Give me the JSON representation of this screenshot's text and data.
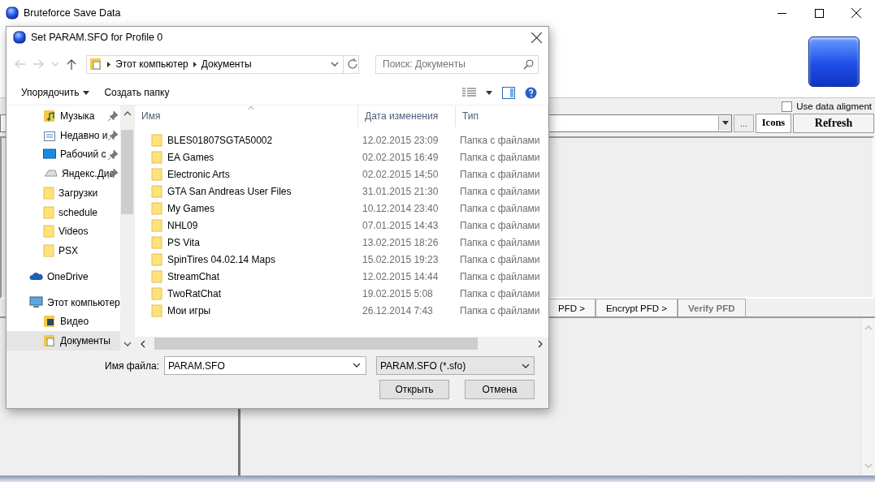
{
  "main_window": {
    "title": "Bruteforce Save Data",
    "align_option": {
      "label": "Use data aligment",
      "checked": false
    },
    "browse_button": "...",
    "buttons": [
      {
        "label": "Icons",
        "kind": "toggle"
      },
      {
        "label": "Refresh",
        "kind": "push"
      }
    ],
    "tabs": [
      {
        "label": "PFD >",
        "selected": false
      },
      {
        "label": "Encrypt PFD >",
        "selected": false
      },
      {
        "label": "Verify PFD",
        "selected": true
      }
    ]
  },
  "dialog": {
    "title": "Set PARAM.SFO for Profile 0",
    "breadcrumb": [
      "Этот компьютер",
      "Документы"
    ],
    "search": {
      "placeholder": "Поиск: Документы"
    },
    "commands": [
      {
        "label": "Упорядочить",
        "kind": "menu"
      },
      {
        "label": "Создать папку",
        "kind": "plain"
      }
    ],
    "quick_access": [
      {
        "label": "Музыка",
        "kind": "music",
        "pinned": true,
        "selected": false
      },
      {
        "label": "Недавно и",
        "kind": "recent",
        "pinned": true,
        "selected": false
      },
      {
        "label": "Рабочий с",
        "kind": "desktop",
        "pinned": true,
        "selected": false
      },
      {
        "label": "Яндекс.Дис",
        "kind": "disk",
        "pinned": true,
        "selected": false
      },
      {
        "label": "Загрузки",
        "kind": "folder",
        "pinned": false,
        "selected": false
      },
      {
        "label": "schedule",
        "kind": "folder",
        "pinned": false,
        "selected": false
      },
      {
        "label": "Videos",
        "kind": "folder",
        "pinned": false,
        "selected": false
      },
      {
        "label": "PSX",
        "kind": "folder",
        "pinned": false,
        "selected": false
      }
    ],
    "nav_roots": [
      {
        "label": "OneDrive",
        "kind": "cloud",
        "selected": false
      },
      {
        "label": "Этот компьютер",
        "kind": "computer",
        "selected": false,
        "children": [
          {
            "label": "Видео",
            "kind": "video",
            "selected": false
          },
          {
            "label": "Документы",
            "kind": "docs",
            "selected": true
          }
        ]
      }
    ],
    "columns": [
      "Имя",
      "Дата изменения",
      "Тип"
    ],
    "rows": [
      {
        "name": "BLES01807SGTA50002",
        "date": "12.02.2015 23:09",
        "type": "Папка с файлами"
      },
      {
        "name": "EA Games",
        "date": "02.02.2015 16:49",
        "type": "Папка с файлами"
      },
      {
        "name": "Electronic Arts",
        "date": "02.02.2015 14:50",
        "type": "Папка с файлами"
      },
      {
        "name": "GTA San Andreas User Files",
        "date": "31.01.2015 21:30",
        "type": "Папка с файлами"
      },
      {
        "name": "My Games",
        "date": "10.12.2014 23:40",
        "type": "Папка с файлами"
      },
      {
        "name": "NHL09",
        "date": "07.01.2015 14:43",
        "type": "Папка с файлами"
      },
      {
        "name": "PS Vita",
        "date": "13.02.2015 18:26",
        "type": "Папка с файлами"
      },
      {
        "name": "SpinTires 04.02.14 Maps",
        "date": "15.02.2015 19:23",
        "type": "Папка с файлами"
      },
      {
        "name": "StreamChat",
        "date": "12.02.2015 14:44",
        "type": "Папка с файлами"
      },
      {
        "name": "TwoRatChat",
        "date": "19.02.2015 5:08",
        "type": "Папка с файлами"
      },
      {
        "name": "Мои игры",
        "date": "26.12.2014 7:43",
        "type": "Папка с файлами"
      }
    ],
    "file_name": {
      "label": "Имя файла:",
      "value": "PARAM.SFO"
    },
    "file_type": "PARAM.SFO (*.sfo)",
    "buttons": [
      "Открыть",
      "Отмена"
    ]
  }
}
